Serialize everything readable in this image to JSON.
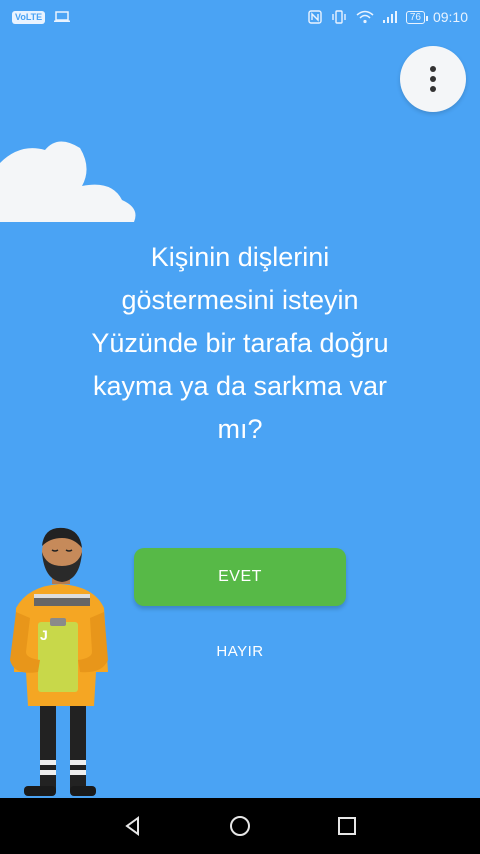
{
  "status_bar": {
    "volte": "VoLTE",
    "battery": "76",
    "time": "09:10"
  },
  "question": {
    "line1": "Kişinin dişlerini",
    "line2": "göstermesini isteyin",
    "line3": "Yüzünde bir tarafa doğru",
    "line4": "kayma ya da sarkma var",
    "line5": "mı?"
  },
  "actions": {
    "yes_label": "EVET",
    "no_label": "HAYIR"
  },
  "colors": {
    "background": "#4aa3f4",
    "yes_button": "#57b947",
    "uniform": "#f5a623",
    "vest": "#c8d84a"
  },
  "icons": [
    "more-vert-icon",
    "back-icon",
    "home-icon",
    "recents-icon",
    "nfc-icon",
    "vibrate-icon",
    "wifi-icon",
    "signal-icon",
    "battery-icon"
  ]
}
